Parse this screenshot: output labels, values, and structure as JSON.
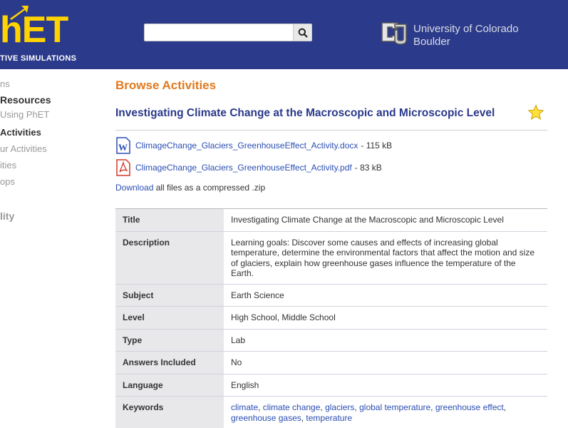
{
  "header": {
    "logo_text": "hET",
    "logo_sub": "TIVE SIMULATIONS",
    "search": {
      "placeholder": "",
      "value": ""
    },
    "university": {
      "line1": "University of Colorado",
      "line2": "Boulder"
    }
  },
  "sidebar": {
    "items": [
      {
        "label": "ns",
        "style": "gray"
      },
      {
        "label": "Resources",
        "style": "bold"
      },
      {
        "label": "Using PhET",
        "style": "gray"
      },
      {
        "label": "Activities",
        "style": "bold"
      },
      {
        "label": "ur Activities",
        "style": "gray"
      },
      {
        "label": "ities",
        "style": "gray"
      },
      {
        "label": "ops",
        "style": "gray"
      },
      {
        "label": "lity",
        "style": "gray"
      }
    ]
  },
  "main": {
    "heading": "Browse Activities",
    "activity_title": "Investigating Climate Change at the Macroscopic and Microscopic Level",
    "files": [
      {
        "name": "ClimageChange_Glaciers_GreenhouseEffect_Activity.docx",
        "size": "- 115 kB",
        "icon": "word-document-icon"
      },
      {
        "name": "ClimageChange_Glaciers_GreenhouseEffect_Activity.pdf",
        "size": "- 83 kB",
        "icon": "pdf-document-icon"
      }
    ],
    "zip": {
      "link": "Download",
      "text": "all files as a compressed .zip"
    },
    "table": [
      {
        "label": "Title",
        "value": "Investigating Climate Change at the Macroscopic and Microscopic Level"
      },
      {
        "label": "Description",
        "value": "Learning goals: Discover some causes and effects of increasing global temperature, determine the environmental factors that affect the motion and size of glaciers, explain how greenhouse gases influence the temperature of the Earth."
      },
      {
        "label": "Subject",
        "value": "Earth Science"
      },
      {
        "label": "Level",
        "value": "High School, Middle School"
      },
      {
        "label": "Type",
        "value": "Lab"
      },
      {
        "label": "Answers Included",
        "value": "No"
      },
      {
        "label": "Language",
        "value": "English"
      }
    ],
    "keywords": {
      "label": "Keywords",
      "items": [
        "climate",
        "climate change",
        "glaciers",
        "global temperature",
        "greenhouse effect",
        "greenhouse gases",
        "temperature"
      ]
    }
  },
  "colors": {
    "header_bg": "#2b3a8a",
    "logo_yellow": "#ffd200",
    "heading_orange": "#e07a1f",
    "title_blue": "#2b3a8a",
    "link_blue": "#2b4fb3",
    "label_bg": "#e8e8ea"
  }
}
